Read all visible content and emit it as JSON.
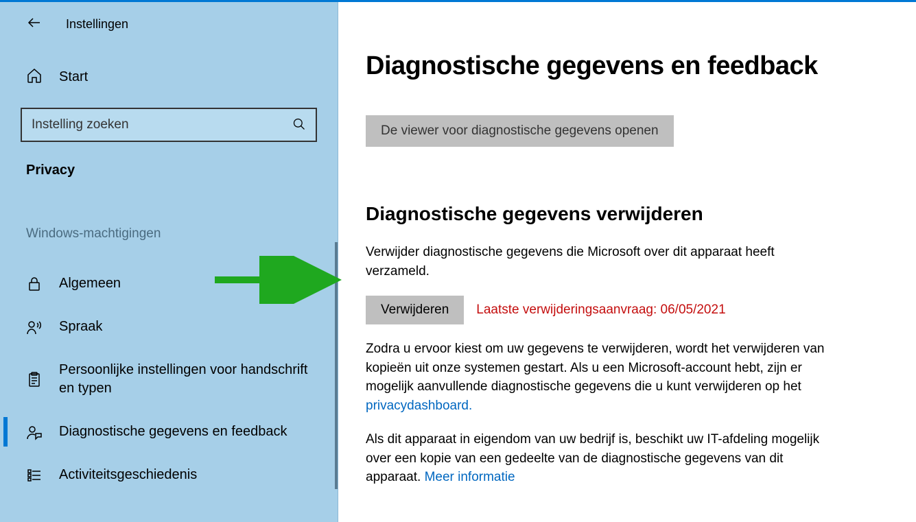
{
  "titlebar": {
    "app_name": "Instellingen"
  },
  "home": {
    "label": "Start"
  },
  "search": {
    "placeholder": "Instelling zoeken"
  },
  "category": "Privacy",
  "group_header": "Windows-machtigingen",
  "nav": {
    "general": "Algemeen",
    "speech": "Spraak",
    "inking": "Persoonlijke instellingen voor handschrift en typen",
    "diagnostics": "Diagnostische gegevens en feedback",
    "activity": "Activiteitsgeschiedenis"
  },
  "main": {
    "page_title": "Diagnostische gegevens en feedback",
    "open_viewer_btn": "De viewer voor diagnostische gegevens openen",
    "delete_section_title": "Diagnostische gegevens verwijderen",
    "delete_intro": "Verwijder diagnostische gegevens die Microsoft over dit apparaat heeft verzameld.",
    "delete_btn": "Verwijderen",
    "last_delete_request": "Laatste verwijderingsaanvraag: 06/05/2021",
    "para2_a": "Zodra u ervoor kiest om uw gegevens te verwijderen, wordt het verwijderen van kopieën uit onze systemen gestart. Als u een Microsoft-account hebt, zijn er mogelijk aanvullende diagnostische gegevens die u kunt verwijderen op het ",
    "para2_link": "privacydashboard.",
    "para3_a": "Als dit apparaat in eigendom van uw bedrijf is, beschikt uw IT-afdeling mogelijk over een kopie van een gedeelte van de diagnostische gegevens van dit apparaat. ",
    "para3_link": "Meer informatie"
  }
}
